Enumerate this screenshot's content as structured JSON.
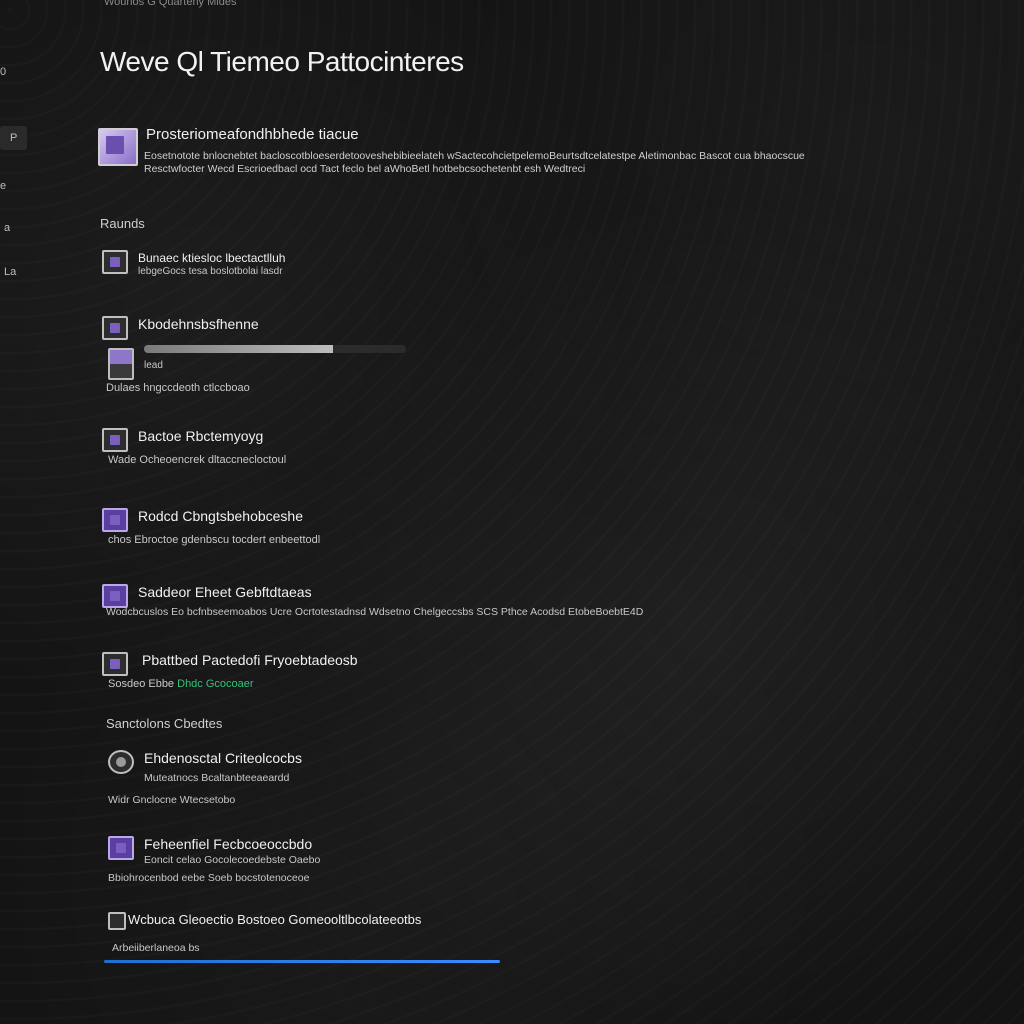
{
  "window": {
    "top_caption": "Wounos G Quarterly Mides",
    "title": "Weve Ql Tiemeo Pattocinteres"
  },
  "rail": {
    "items": [
      {
        "label": "0"
      },
      {
        "label": "P"
      },
      {
        "label": "e"
      },
      {
        "label": "a"
      },
      {
        "label": "La"
      }
    ]
  },
  "header": {
    "title": "Prosteriomeafondhbhede tiacue",
    "description_line1": "Eosetnotote bnlocnebtet bacloscotbloeserdetooveshebibieelateh wSactecohcietpelemoBeurtsdtcelatestpe Aletimonbac Bascot cua bhaocscue",
    "description_line2": "Resctwfocter Wecd Escrioedbacl ocd Tact feclo bel aWhoBetl hotbebcsochetenbt esh Wedtreci"
  },
  "sections": [
    {
      "label": "Raunds",
      "items": [
        {
          "title": "Bunaec ktiesloc lbectactlluh",
          "subtitle": "lebgeGocs tesa boslotbolai lasdr"
        },
        {
          "title": "Kbodehnsbsfhenne",
          "subtitle": "lead",
          "progress": 0.72,
          "subtitle2": "Dulaes hngccdeoth ctlccboao"
        },
        {
          "title": "Bactoe Rbctemyoyg",
          "subtitle": "Wade Ocheoencrek dltaccnecloctoul"
        },
        {
          "title": "Rodcd Cbngtsbehobceshe",
          "subtitle": "chos Ebroctoe gdenbscu tocdert enbeettodl"
        },
        {
          "title": "Saddeor Eheet Gebftdtaeas",
          "subtitle": "Wodcbcuslos Eo bcfnbseemoabos Ucre Ocrtotestadnsd Wdsetno Chelgeccsbs SCS Pthce Acodsd EtobeBoebtE4D"
        },
        {
          "title": "Pbattbed Pactedofi Fryoebtadeosb",
          "subtitle": "Sosdeo Ebbe",
          "subtitle_accent": "Dhdc Gcocoaer"
        }
      ]
    },
    {
      "label": "Sanctolons Cbedtes",
      "items": [
        {
          "title": "Ehdenosctal Criteolcocbs",
          "subtitle": "Muteatnocs Bcaltanbteeaeardd",
          "subtitle2": "Widr Gnclocne Wtecsetobo"
        },
        {
          "title": "Feheenfiel Fecbcoeoccbdo",
          "subtitle": "Eoncit celao Gocolecoedebste Oaebo",
          "subtitle2": "Bbiohrocenbod eebe Soeb bocstotenoceoe"
        },
        {
          "title": "Wcbuca Gleoectio Bostoeo Gomeooltlbcolateeotbs",
          "subtitle": "Arbeiiberlaneoa bs"
        }
      ]
    }
  ],
  "colors": {
    "background": "#141414",
    "accent_purple": "#7a5fc0",
    "accent_green": "#34c27a",
    "accent_blue": "#1f6fd1"
  }
}
